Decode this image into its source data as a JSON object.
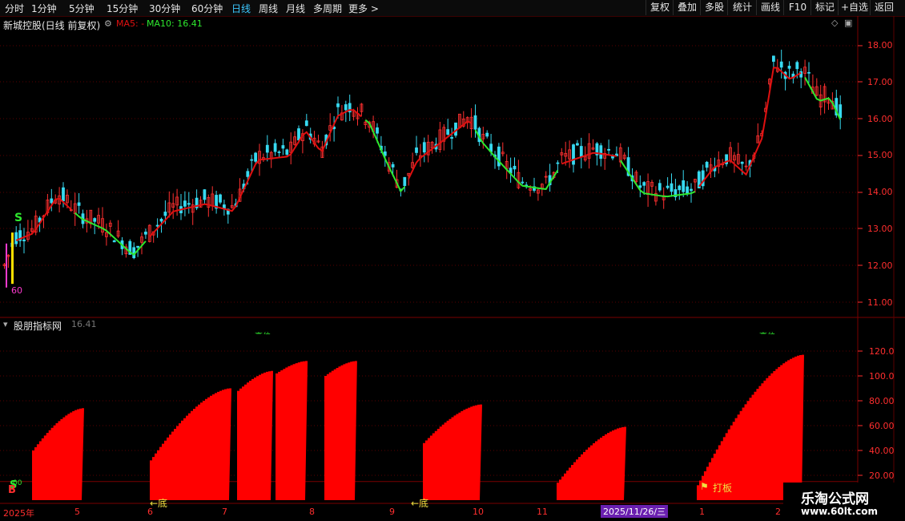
{
  "toolbar": {
    "periods": [
      "分时",
      "1分钟",
      "5分钟",
      "15分钟",
      "30分钟",
      "60分钟",
      "日线",
      "周线",
      "月线",
      "多周期",
      "更多 >"
    ],
    "active_period": "日线",
    "actions": [
      "复权",
      "叠加",
      "多股",
      "统计",
      "画线",
      "F10",
      "标记",
      "+自选",
      "返回"
    ]
  },
  "main_chart": {
    "stock_title": "新城控股(日线 前复权)",
    "ma5_label": "MA5: -",
    "ma10_label": "MA10: 16.41",
    "y_ticks": [
      "18.00",
      "17.00",
      "16.00",
      "15.00",
      "14.00",
      "13.00",
      "12.00",
      "11.00"
    ],
    "marker_s": "S",
    "marker_num": "60"
  },
  "indicator_panel": {
    "title": "股朋指标网",
    "value": "16.41",
    "y_ticks": [
      "120.0",
      "100.0",
      "80.00",
      "60.00",
      "40.00",
      "20.00"
    ],
    "labels": {
      "bottom1": "←底",
      "bottom2": "←底",
      "daban": "打板",
      "b_marker": "B",
      "s_marker": "S",
      "num": "00",
      "top1": "高位",
      "top2": "高位"
    }
  },
  "date_axis": {
    "labels": [
      "2025年",
      "5",
      "6",
      "7",
      "8",
      "9",
      "10",
      "11",
      "1",
      "2"
    ],
    "cursor_date": "2025/11/26/三"
  },
  "watermark": {
    "name": "乐淘公式网",
    "url": "www.60lt.com"
  },
  "colors": {
    "up": "#ff3030",
    "down": "#37d9f0",
    "ma5": "#e01010",
    "ma10": "#2ee82e",
    "bar": "#ff0000",
    "accent": "#3cc8ff"
  },
  "chart_data": {
    "type": "candlestick",
    "title": "新城控股(日线 前复权)",
    "price_range": [
      10.8,
      18.6
    ],
    "y_ticks": [
      11,
      12,
      13,
      14,
      15,
      16,
      17,
      18
    ],
    "indicator": {
      "name": "股朋指标网",
      "range": [
        0,
        125
      ]
    }
  }
}
